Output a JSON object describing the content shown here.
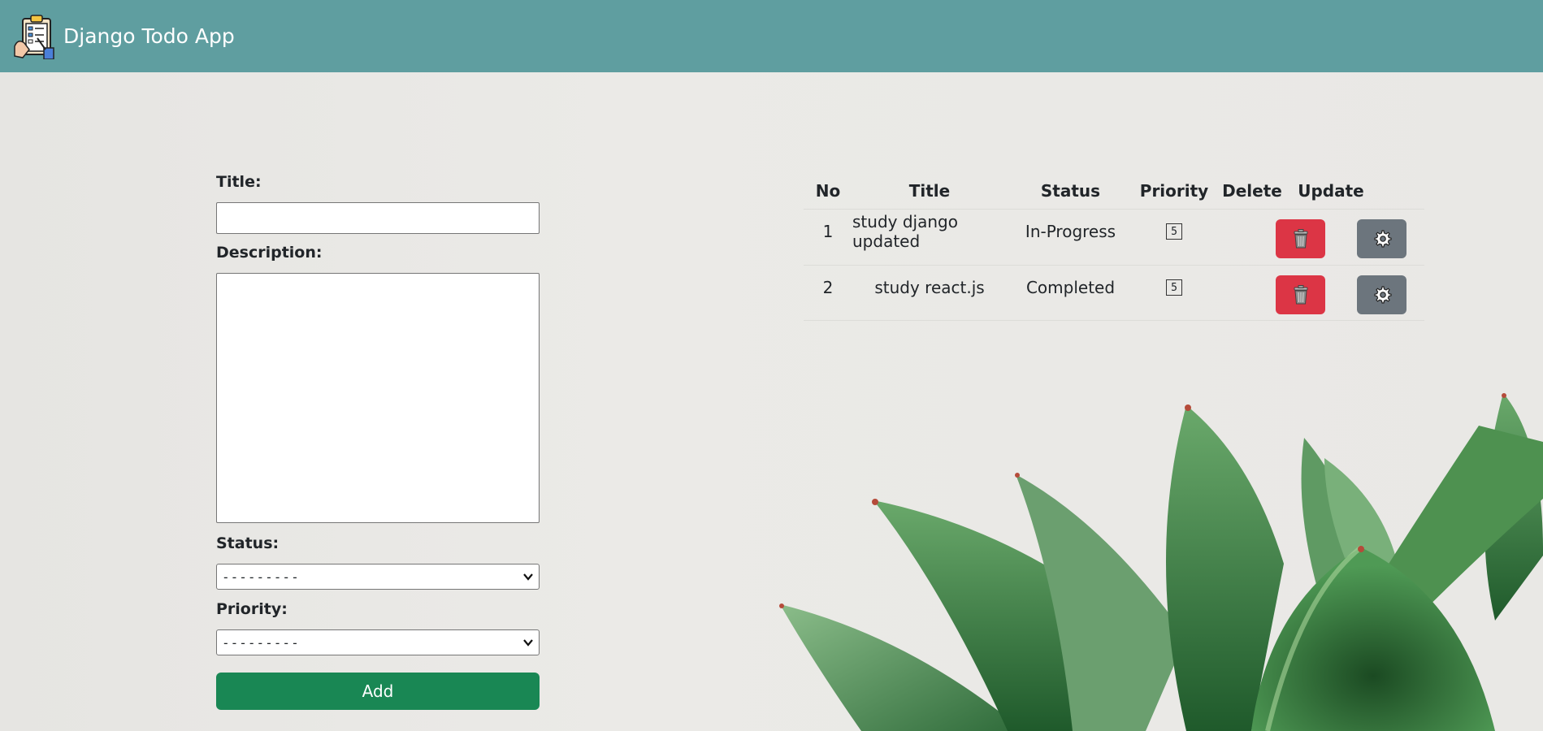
{
  "app": {
    "brand": "Django Todo App",
    "colors": {
      "navbar": "#5f9ea0",
      "add": "#198754",
      "delete": "#dc3545",
      "update": "#6c757d"
    }
  },
  "form": {
    "title_label": "Title:",
    "title_value": "",
    "description_label": "Description:",
    "description_value": "",
    "status_label": "Status:",
    "status_selected": "---------",
    "priority_label": "Priority:",
    "priority_selected": "---------",
    "add_label": "Add"
  },
  "table": {
    "headers": [
      "No",
      "Title",
      "Status",
      "Priority",
      "Delete",
      "Update"
    ],
    "rows": [
      {
        "no": "1",
        "title": "study django updated",
        "status": "In-Progress",
        "priority": "5",
        "delete_icon": "trash-icon",
        "update_icon": "gear-icon"
      },
      {
        "no": "2",
        "title": "study react.js",
        "status": "Completed",
        "priority": "5",
        "delete_icon": "trash-icon",
        "update_icon": "gear-icon"
      }
    ]
  }
}
